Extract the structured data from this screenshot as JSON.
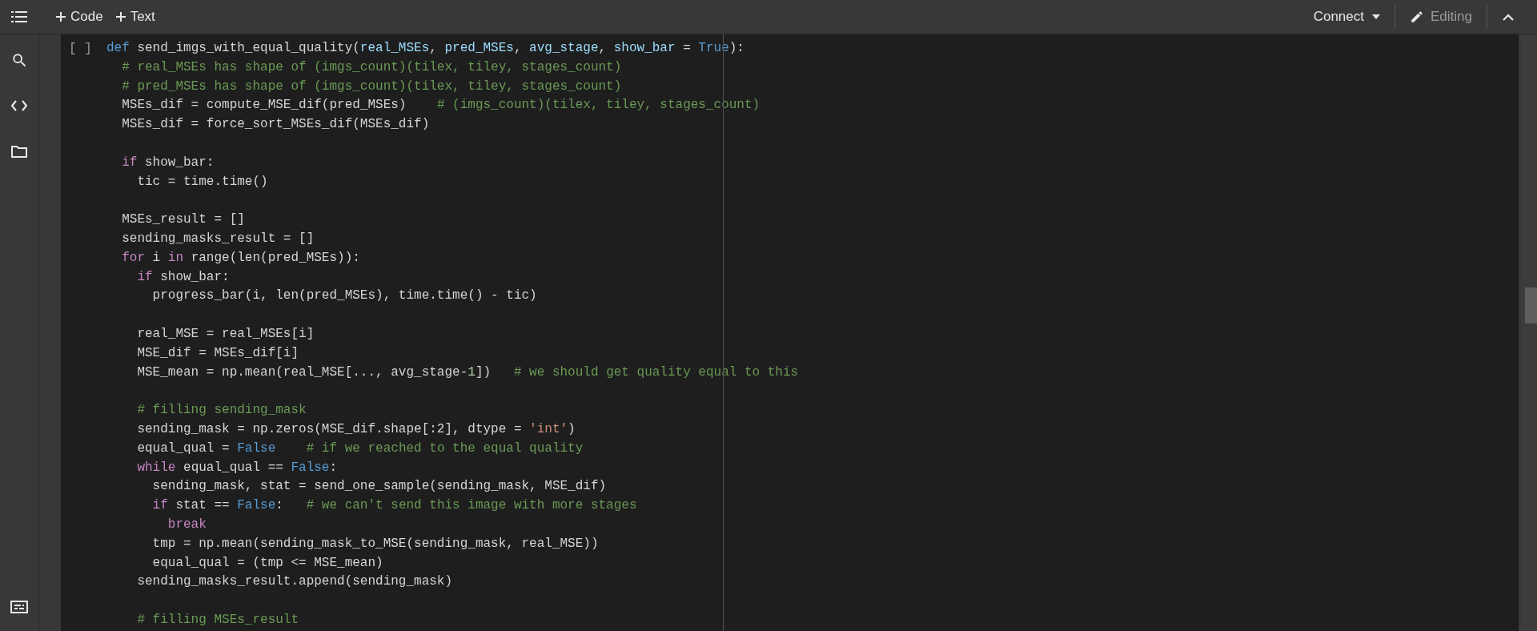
{
  "toolbar": {
    "insert_buttons": [
      "Code",
      "Text"
    ],
    "connect": "Connect",
    "editing": {
      "label": "Editing",
      "disabled": true
    }
  },
  "cell": {
    "run_label": "[ ]",
    "lines": [
      {
        "kind": "code",
        "tokens": [
          {
            "text": "def",
            "kind": "keyword"
          },
          {
            "text": " send_imgs_with_equal_quality(",
            "kind": "plain"
          },
          {
            "text": "real_MSEs",
            "kind": "param"
          },
          {
            "text": ", ",
            "kind": "plain"
          },
          {
            "text": "pred_MSEs",
            "kind": "param"
          },
          {
            "text": ", ",
            "kind": "plain"
          },
          {
            "text": "avg_stage",
            "kind": "param"
          },
          {
            "text": ", ",
            "kind": "plain"
          },
          {
            "text": "show_bar",
            "kind": "param"
          },
          {
            "text": " = ",
            "kind": "plain"
          },
          {
            "text": "True",
            "kind": "keyword"
          },
          {
            "text": "):",
            "kind": "plain"
          }
        ]
      },
      {
        "kind": "code",
        "tokens": [
          {
            "text": "  # real_MSEs has shape of (imgs_count)(tilex, tiley, stages_count)",
            "kind": "comment"
          }
        ]
      },
      {
        "kind": "code",
        "tokens": [
          {
            "text": "  # pred_MSEs has shape of (imgs_count)(tilex, tiley, stages_count)",
            "kind": "comment"
          }
        ]
      },
      {
        "kind": "code",
        "tokens": [
          {
            "text": "  MSEs_dif = compute_MSE_dif(pred_MSEs)    ",
            "kind": "plain"
          },
          {
            "text": "# (imgs_count)(tilex, tiley, stages_count)",
            "kind": "comment"
          }
        ]
      },
      {
        "kind": "code",
        "tokens": [
          {
            "text": "  MSEs_dif = force_sort_MSEs_dif(MSEs_dif)",
            "kind": "plain"
          }
        ]
      },
      {
        "kind": "blank"
      },
      {
        "kind": "code",
        "tokens": [
          {
            "text": "  if",
            "kind": "control"
          },
          {
            "text": " show_bar:",
            "kind": "plain"
          }
        ]
      },
      {
        "kind": "code",
        "tokens": [
          {
            "text": "    tic = time.time()",
            "kind": "plain"
          }
        ]
      },
      {
        "kind": "blank"
      },
      {
        "kind": "code",
        "tokens": [
          {
            "text": "  MSEs_result = []",
            "kind": "plain"
          }
        ]
      },
      {
        "kind": "code",
        "tokens": [
          {
            "text": "  sending_masks_result = []",
            "kind": "plain"
          }
        ]
      },
      {
        "kind": "code",
        "tokens": [
          {
            "text": "  for",
            "kind": "control"
          },
          {
            "text": " i ",
            "kind": "plain"
          },
          {
            "text": "in",
            "kind": "control"
          },
          {
            "text": " range(len(pred_MSEs)):",
            "kind": "plain"
          }
        ]
      },
      {
        "kind": "code",
        "tokens": [
          {
            "text": "    if",
            "kind": "control"
          },
          {
            "text": " show_bar:",
            "kind": "plain"
          }
        ]
      },
      {
        "kind": "code",
        "tokens": [
          {
            "text": "      progress_bar(i, len(pred_MSEs), time.time() - tic)",
            "kind": "plain"
          }
        ]
      },
      {
        "kind": "blank"
      },
      {
        "kind": "code",
        "tokens": [
          {
            "text": "    real_MSE = real_MSEs[i]",
            "kind": "plain"
          }
        ]
      },
      {
        "kind": "code",
        "tokens": [
          {
            "text": "    MSE_dif = MSEs_dif[i]",
            "kind": "plain"
          }
        ]
      },
      {
        "kind": "code",
        "tokens": [
          {
            "text": "    MSE_mean = np.mean(real_MSE[..., avg_stage-",
            "kind": "plain"
          },
          {
            "text": "1",
            "kind": "number"
          },
          {
            "text": "])   ",
            "kind": "plain"
          },
          {
            "text": "# we should get quality equal to this",
            "kind": "comment"
          }
        ]
      },
      {
        "kind": "blank"
      },
      {
        "kind": "code",
        "tokens": [
          {
            "text": "    # filling sending_mask",
            "kind": "comment"
          }
        ]
      },
      {
        "kind": "code",
        "tokens": [
          {
            "text": "    sending_mask = np.zeros(MSE_dif.shape[:2], dtype = ",
            "kind": "plain"
          },
          {
            "text": "'int'",
            "kind": "string"
          },
          {
            "text": ")",
            "kind": "plain"
          }
        ]
      },
      {
        "kind": "code",
        "tokens": [
          {
            "text": "    equal_qual = ",
            "kind": "plain"
          },
          {
            "text": "False",
            "kind": "keyword"
          },
          {
            "text": "    # if we reached to the equal quality",
            "kind": "comment"
          }
        ]
      },
      {
        "kind": "code",
        "tokens": [
          {
            "text": "    while",
            "kind": "control"
          },
          {
            "text": " equal_qual == ",
            "kind": "plain"
          },
          {
            "text": "False",
            "kind": "keyword"
          },
          {
            "text": ":",
            "kind": "plain"
          }
        ]
      },
      {
        "kind": "code",
        "tokens": [
          {
            "text": "      sending_mask, stat = send_one_sample(sending_mask, MSE_dif)",
            "kind": "plain"
          }
        ]
      },
      {
        "kind": "code",
        "tokens": [
          {
            "text": "      if",
            "kind": "control"
          },
          {
            "text": " stat == ",
            "kind": "plain"
          },
          {
            "text": "False",
            "kind": "keyword"
          },
          {
            "text": ":   ",
            "kind": "plain"
          },
          {
            "text": "# we can't send this image with more stages",
            "kind": "comment"
          }
        ]
      },
      {
        "kind": "code",
        "tokens": [
          {
            "text": "        break",
            "kind": "control"
          }
        ]
      },
      {
        "kind": "code",
        "tokens": [
          {
            "text": "      tmp = np.mean(sending_mask_to_MSE(sending_mask, real_MSE))",
            "kind": "plain"
          }
        ]
      },
      {
        "kind": "code",
        "tokens": [
          {
            "text": "      equal_qual = (tmp <= MSE_mean)",
            "kind": "plain"
          }
        ]
      },
      {
        "kind": "code",
        "tokens": [
          {
            "text": "    sending_masks_result.append(sending_mask)",
            "kind": "plain"
          }
        ]
      },
      {
        "kind": "blank"
      },
      {
        "kind": "code",
        "tokens": [
          {
            "text": "    # filling MSEs_result",
            "kind": "comment"
          }
        ]
      }
    ]
  }
}
